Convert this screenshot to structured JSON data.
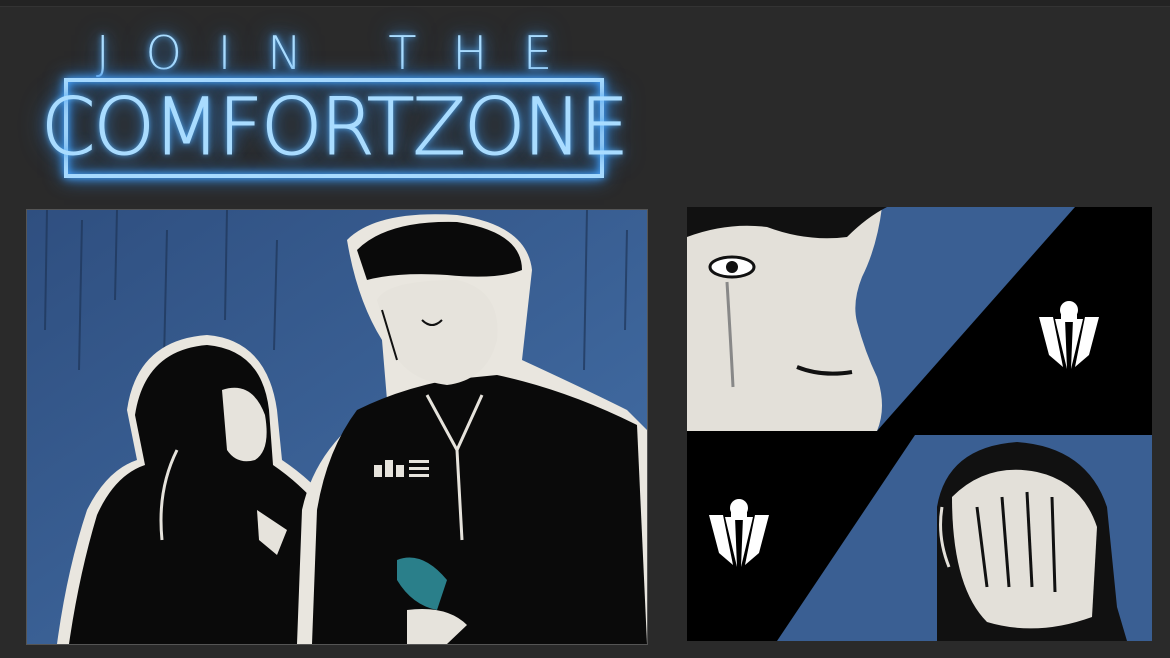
{
  "header": {
    "join_text": "JOIN THE",
    "logo_text": "COMFORTZONE"
  },
  "colors": {
    "background": "#2a2a2a",
    "neon": "#a9dcff",
    "panel_blue": "#3a5f93",
    "ink": "#000000",
    "paper": "#e6e3dc"
  },
  "icons": [
    "crown-emblem-icon",
    "crown-emblem-icon"
  ]
}
